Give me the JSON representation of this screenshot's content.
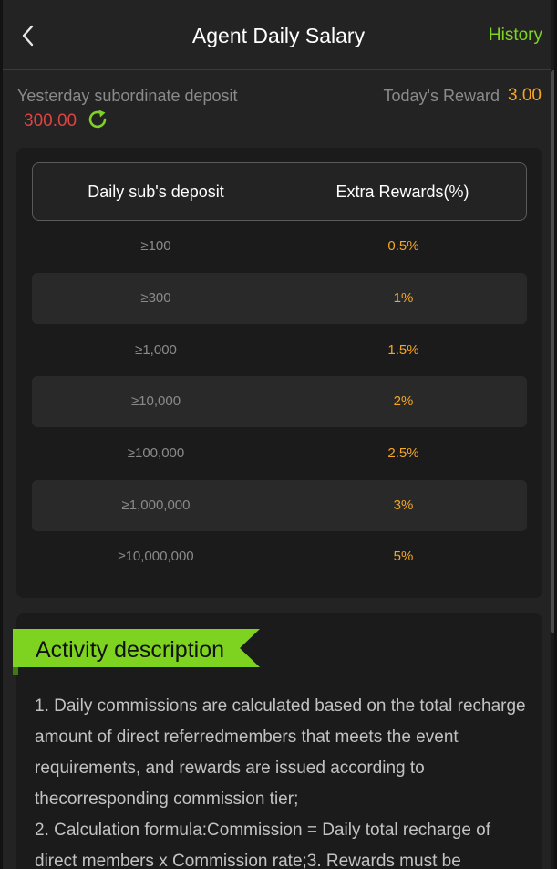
{
  "header": {
    "title": "Agent Daily Salary",
    "history_label": "History",
    "back_icon": "chevron-left-icon"
  },
  "stats": {
    "deposit_label": "Yesterday subordinate deposit",
    "deposit_value": "300.00",
    "refresh_icon": "refresh-icon",
    "reward_label": "Today's Reward",
    "reward_value": "3.00"
  },
  "table": {
    "headers": [
      "Daily sub's deposit",
      "Extra Rewards(%)"
    ],
    "rows": [
      {
        "deposit": "≥100",
        "reward": "0.5%"
      },
      {
        "deposit": "≥300",
        "reward": "1%"
      },
      {
        "deposit": "≥1,000",
        "reward": "1.5%"
      },
      {
        "deposit": "≥10,000",
        "reward": "2%"
      },
      {
        "deposit": "≥100,000",
        "reward": "2.5%"
      },
      {
        "deposit": "≥1,000,000",
        "reward": "3%"
      },
      {
        "deposit": "≥10,000,000",
        "reward": "5%"
      }
    ]
  },
  "description": {
    "title": "Activity description",
    "lines": [
      "1. Daily commissions are calculated based on the total recharge amount of direct referredmembers that meets the event requirements, and rewards are issued according to thecorresponding commission tier;",
      "2. Calculation formula:Commission = Daily total recharge of direct members x Commission rate;3. Rewards must be"
    ]
  },
  "colors": {
    "accent_green": "#7ed321",
    "accent_orange": "#f5a623",
    "deposit_red": "#e04242"
  }
}
